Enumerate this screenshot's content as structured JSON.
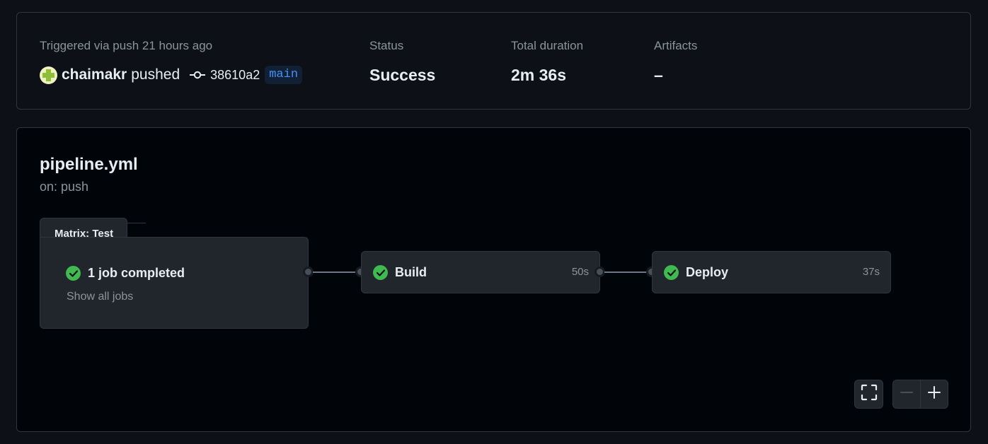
{
  "summary": {
    "trigger_label": "Triggered via push 21 hours ago",
    "actor": "chaimakr",
    "action": "pushed",
    "commit_sha": "38610a2",
    "branch": "main",
    "status_label": "Status",
    "status_value": "Success",
    "duration_label": "Total duration",
    "duration_value": "2m 36s",
    "artifacts_label": "Artifacts",
    "artifacts_value": "–"
  },
  "workflow": {
    "file": "pipeline.yml",
    "trigger": "on: push"
  },
  "matrix": {
    "tab_label": "Matrix: Test",
    "summary": "1 job completed",
    "show_all": "Show all jobs"
  },
  "jobs": [
    {
      "name": "Build",
      "duration": "50s",
      "status": "success"
    },
    {
      "name": "Deploy",
      "duration": "37s",
      "status": "success"
    }
  ],
  "icons": {
    "status_success": "check-circle-icon",
    "commit": "git-commit-icon",
    "fullscreen": "fullscreen-icon",
    "zoom_out": "minus-icon",
    "zoom_in": "plus-icon"
  },
  "colors": {
    "success": "#3fb950",
    "branch_text": "#4493f8",
    "branch_bg": "#122035",
    "background": "#0d1117",
    "graph_bg": "#010409"
  }
}
